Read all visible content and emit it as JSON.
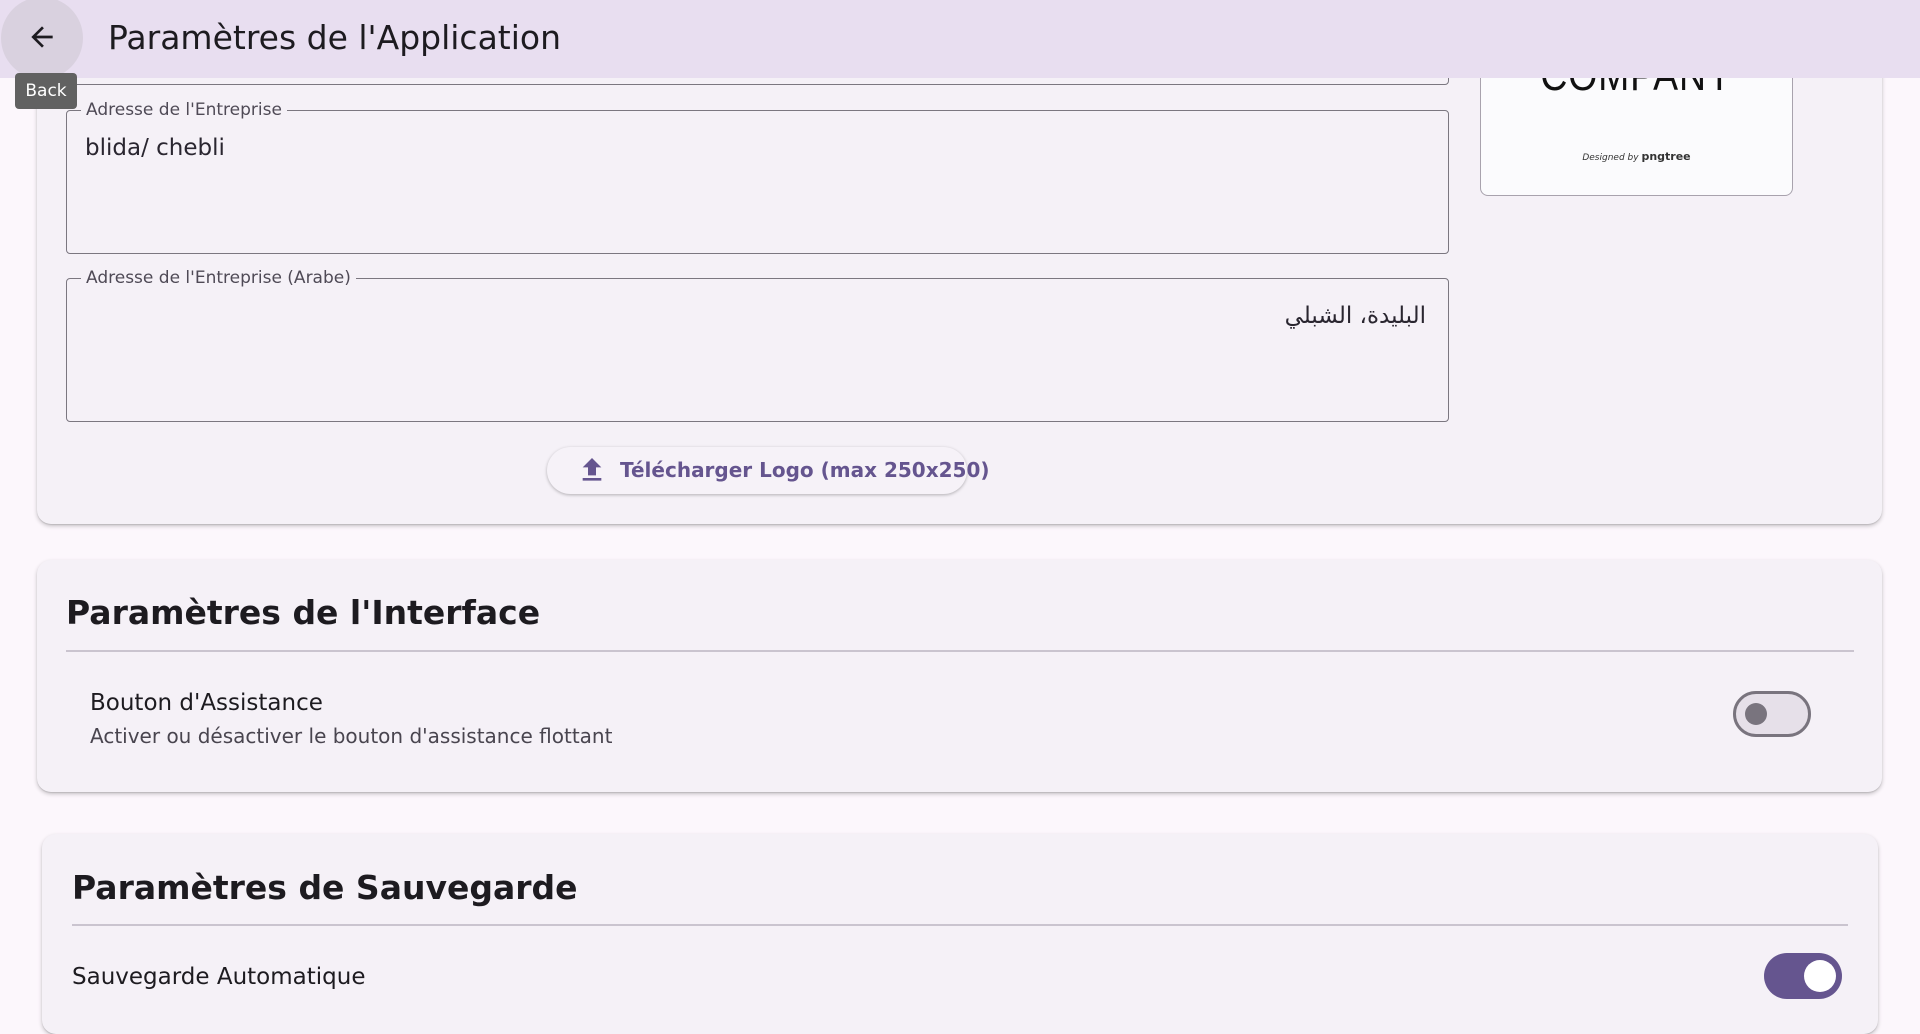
{
  "app_bar": {
    "title": "Paramètres de l'Application",
    "back_tooltip": "Back",
    "back_icon": "arrow-left-icon"
  },
  "company": {
    "address_label": "Adresse de l'Entreprise",
    "address_value": "blida/ chebli",
    "address_ar_label": "Adresse de l'Entreprise (Arabe)",
    "address_ar_value": "البليدة، الشبلي",
    "upload_icon": "upload-icon",
    "upload_button": "Télécharger Logo (max 250x250)",
    "logo_text": "COMPANY",
    "logo_credit_prefix": "Designed by",
    "logo_credit_brand": "pngtree"
  },
  "interface": {
    "title": "Paramètres de l'Interface",
    "assist_title": "Bouton d'Assistance",
    "assist_subtitle": "Activer ou désactiver le bouton d'assistance flottant",
    "assist_enabled": false
  },
  "backup": {
    "title": "Paramètres de Sauvegarde",
    "auto_title": "Sauvegarde Automatique",
    "auto_enabled": true
  },
  "colors": {
    "accent": "#65558f",
    "app_bar_bg": "#e8def0",
    "tooltip_bg": "#616161"
  }
}
